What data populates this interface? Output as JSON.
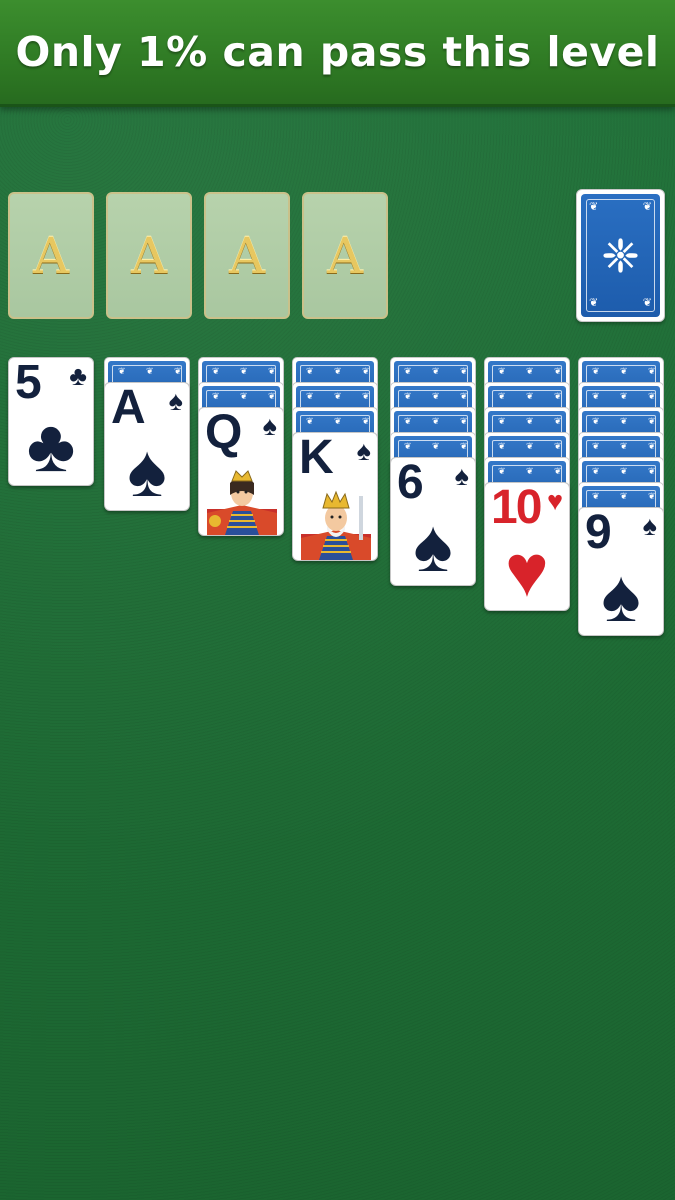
{
  "banner": {
    "title": "Only 1% can pass this level"
  },
  "foundations": [
    {
      "label": "A"
    },
    {
      "label": "A"
    },
    {
      "label": "A"
    },
    {
      "label": "A"
    }
  ],
  "stock": {
    "face": "down",
    "emblem": "damask-ornament-icon"
  },
  "colors": {
    "felt": "#1c6a30",
    "banner": "#2f7a24",
    "card_back": "#1d5cac",
    "red_suit": "#d8232a",
    "black_suit": "#13213d"
  },
  "tableau": [
    {
      "hidden": 0,
      "rank": "5",
      "suit": "♣",
      "color": "black",
      "face_art": false
    },
    {
      "hidden": 1,
      "rank": "A",
      "suit": "♠",
      "color": "black",
      "face_art": false
    },
    {
      "hidden": 2,
      "rank": "Q",
      "suit": "♠",
      "color": "black",
      "face_art": true
    },
    {
      "hidden": 3,
      "rank": "K",
      "suit": "♠",
      "color": "black",
      "face_art": true
    },
    {
      "hidden": 4,
      "rank": "6",
      "suit": "♠",
      "color": "black",
      "face_art": false
    },
    {
      "hidden": 5,
      "rank": "10",
      "suit": "♥",
      "color": "red",
      "face_art": false
    },
    {
      "hidden": 6,
      "rank": "9",
      "suit": "♠",
      "color": "black",
      "face_art": false
    }
  ]
}
